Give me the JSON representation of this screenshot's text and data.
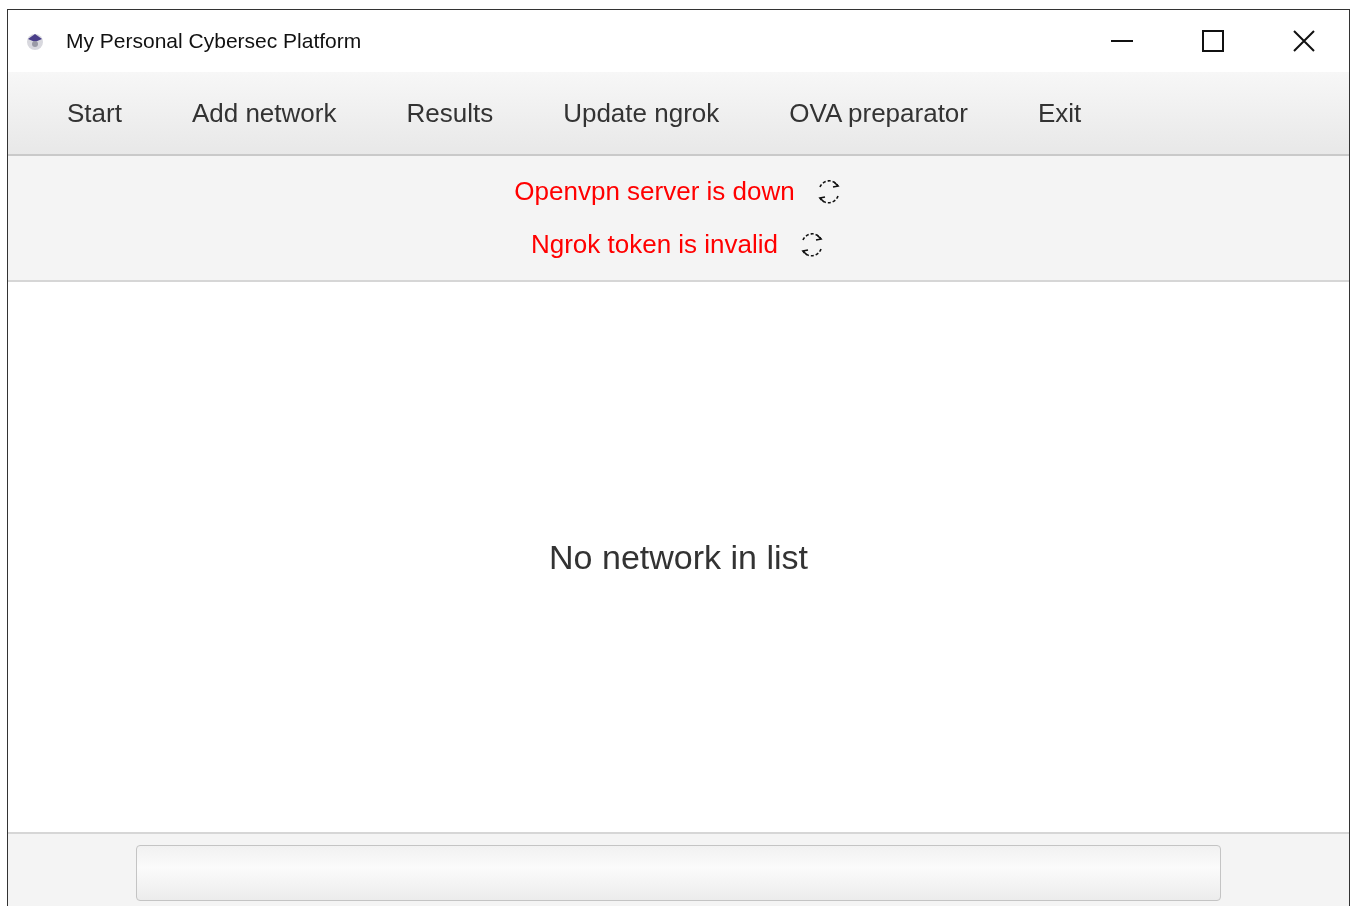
{
  "window": {
    "title": "My Personal Cybersec Platform"
  },
  "menu": [
    {
      "label": "Start"
    },
    {
      "label": "Add network"
    },
    {
      "label": "Results"
    },
    {
      "label": "Update ngrok"
    },
    {
      "label": "OVA preparator"
    },
    {
      "label": "Exit"
    }
  ],
  "status_messages": [
    {
      "text": "Openvpn server is down",
      "color": "#ff0000"
    },
    {
      "text": "Ngrok token is invalid",
      "color": "#ff0000"
    }
  ],
  "content": {
    "empty_message": "No network in list"
  },
  "progress_bar": {
    "level": 0
  }
}
